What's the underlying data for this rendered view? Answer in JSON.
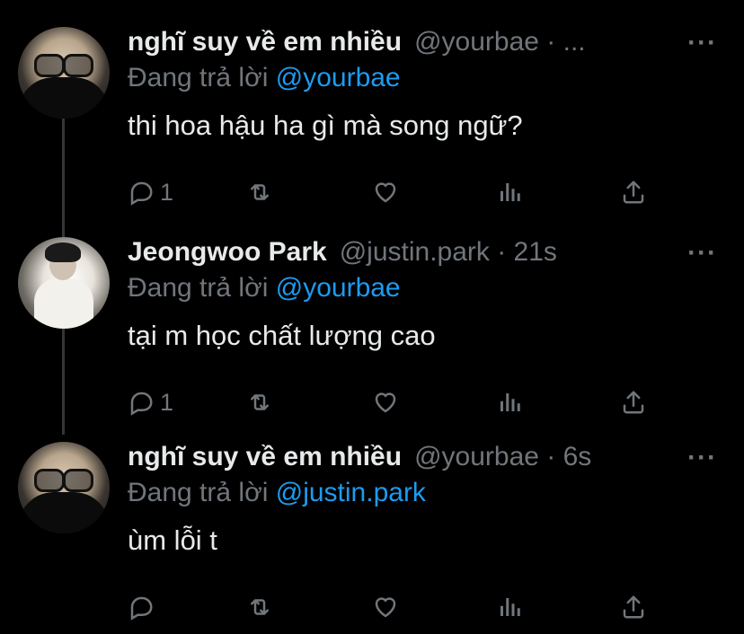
{
  "tweets": [
    {
      "name": "nghĩ suy về em nhiều",
      "handle_time": "@yourbae · ...",
      "replying_prefix": "Đang trả lời",
      "replying_to": "@yourbae",
      "content": "thi hoa hậu ha gì mà song ngữ?",
      "reply_count": "1",
      "more_label": "···"
    },
    {
      "name": "Jeongwoo Park",
      "handle_time": "@justin.park · 21s",
      "replying_prefix": "Đang trả lời",
      "replying_to": "@yourbae",
      "content": "tại m học chất lượng cao",
      "reply_count": "1",
      "more_label": "···"
    },
    {
      "name": "nghĩ suy về em nhiều",
      "handle_time": "@yourbae · 6s",
      "replying_prefix": "Đang trả lời",
      "replying_to": "@justin.park",
      "content": "ùm lỗi t",
      "reply_count": "",
      "more_label": "···"
    }
  ],
  "colors": {
    "background": "#000000",
    "text": "#e7e9ea",
    "muted": "#71767b",
    "mention": "#1d9bf0"
  },
  "icons": [
    "reply-icon",
    "retweet-icon",
    "like-icon",
    "views-icon",
    "share-icon",
    "more-icon"
  ]
}
